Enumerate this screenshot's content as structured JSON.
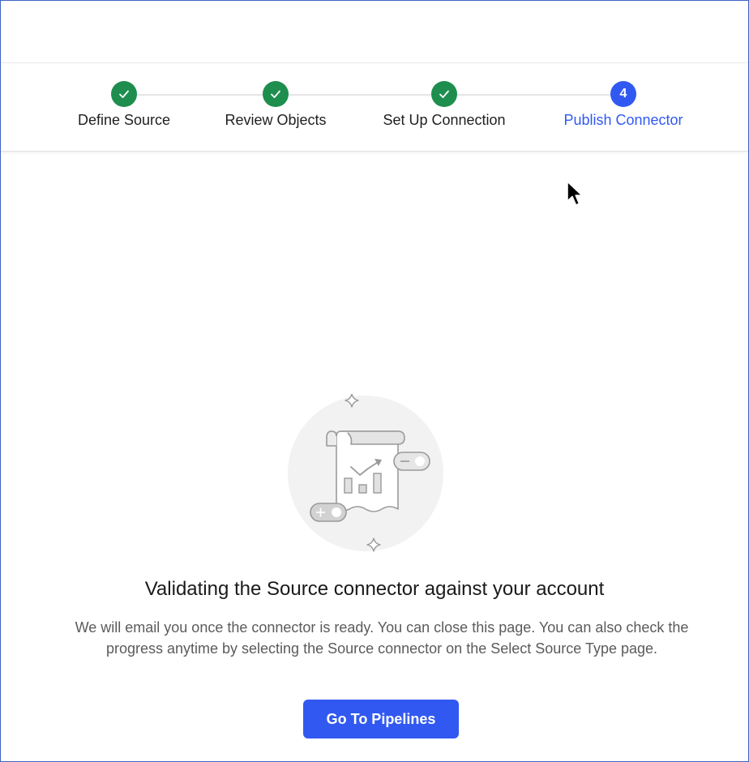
{
  "stepper": {
    "steps": [
      {
        "label": "Define Source",
        "status": "done",
        "icon": "check-icon"
      },
      {
        "label": "Review Objects",
        "status": "done",
        "icon": "check-icon"
      },
      {
        "label": "Set Up Connection",
        "status": "done",
        "icon": "check-icon"
      },
      {
        "label": "Publish Connector",
        "status": "active",
        "number": "4"
      }
    ]
  },
  "main": {
    "illustration": "document-chart-toggle-illustration",
    "title": "Validating the Source connector against your account",
    "description": "We will email you once the connector is ready. You can close this page. You can also check the progress anytime by selecting the Source connector on the Select Source Type page.",
    "cta_label": "Go To Pipelines"
  },
  "colors": {
    "done": "#1e8e4e",
    "active": "#3159f2",
    "frame_border": "#3b63c4"
  }
}
